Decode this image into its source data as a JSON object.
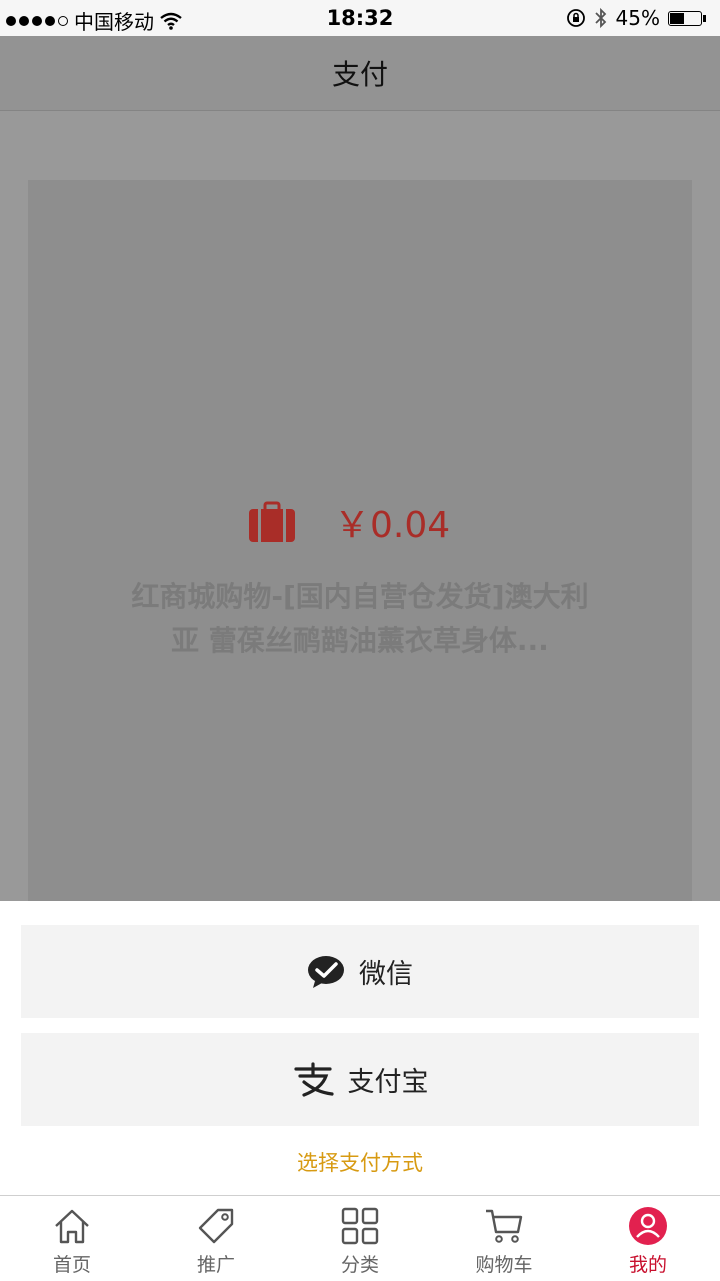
{
  "status_bar": {
    "carrier": "中国移动",
    "time": "18:32",
    "battery": "45%",
    "battery_level": 0.45
  },
  "header": {
    "title": "支付"
  },
  "product": {
    "price": "￥0.04",
    "title": "红商城购物-[国内自营仓发货]澳大利亚 蕾葆丝鸸鹋油薰衣草身体..."
  },
  "payment": {
    "wechat_label": "微信",
    "alipay_label": "支付宝",
    "choose_label": "选择支付方式"
  },
  "tabs": [
    {
      "label": "首页",
      "icon": "home-icon"
    },
    {
      "label": "推广",
      "icon": "tag-icon"
    },
    {
      "label": "分类",
      "icon": "grid-icon"
    },
    {
      "label": "购物车",
      "icon": "cart-icon"
    },
    {
      "label": "我的",
      "icon": "user-icon",
      "active": true
    }
  ],
  "colors": {
    "accent_red": "#c8102e",
    "price_red": "#a92d28",
    "hint_orange": "#d79a12"
  }
}
